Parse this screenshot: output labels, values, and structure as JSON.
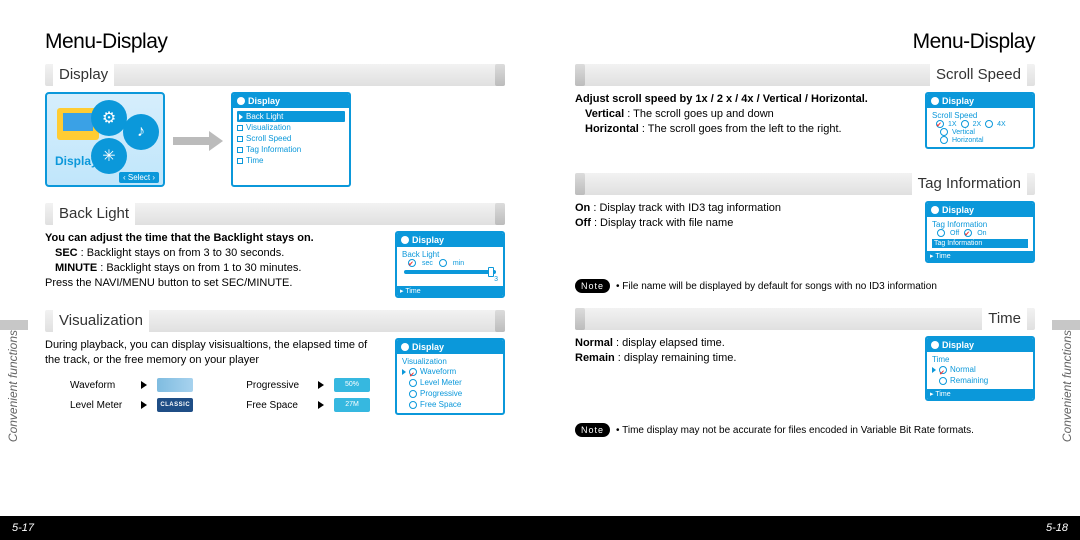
{
  "title": "Menu-Display",
  "section_side_text": "Convenient functions",
  "left": {
    "page_no": "5-17",
    "sections": {
      "display": {
        "title": "Display",
        "icon_label": "Display",
        "select_hint": "‹ Select ›",
        "shot": {
          "header": "Display",
          "selected": "Back Light",
          "items": [
            "Back Light",
            "Visualization",
            "Scroll Speed",
            "Tag Information",
            "Time"
          ]
        }
      },
      "backlight": {
        "title": "Back Light",
        "lead": "You can adjust the time that the Backlight stays on.",
        "line1a": "SEC",
        "line1b": " : Backlight stays on from 3 to 30 seconds.",
        "line2a": "MINUTE",
        "line2b": " : Backlight stays on from 1 to 30 minutes.",
        "line3": "Press the NAVI/MENU button to set SEC/MINUTE.",
        "shot": {
          "header": "Display",
          "sub": "Back Light",
          "opt1": "sec",
          "opt2": "min",
          "slider_val": "3",
          "time": "Time"
        }
      },
      "viz": {
        "title": "Visualization",
        "desc": "During playback, you can display visisualtions, the elapsed time of the track, or the free memory on your player",
        "items": {
          "waveform": "Waveform",
          "progressive": "Progressive",
          "levelmeter": "Level Meter",
          "freespace": "Free Space"
        },
        "chips": {
          "prog": "50%",
          "level": "CLASSIC",
          "free": "27M"
        },
        "shot": {
          "header": "Display",
          "sub": "Visualization",
          "items": [
            "Waveform",
            "Level Meter",
            "Progressive",
            "Free Space"
          ]
        }
      }
    }
  },
  "right": {
    "page_no": "5-18",
    "sections": {
      "scroll": {
        "title": "Scroll Speed",
        "lead": "Adjust scroll speed by 1x / 2 x / 4x / Vertical / Horizontal.",
        "l1a": "Vertical",
        "l1b": " : The scroll goes up and down",
        "l2a": "Horizontal",
        "l2b": " : The scroll goes from the left to the right.",
        "shot": {
          "header": "Display",
          "sub": "Scroll Speed",
          "row1": [
            "1X",
            "2X",
            "4X"
          ],
          "row2": [
            "Vertical"
          ],
          "row3": [
            "Horizontal"
          ]
        }
      },
      "tag": {
        "title": "Tag Information",
        "l1a": "On",
        "l1b": " : Display track with ID3 tag information",
        "l2a": "Off",
        "l2b": " : Display track with file name",
        "note": "File name will be displayed by default for songs with no ID3 information",
        "shot": {
          "header": "Display",
          "sub": "Tag Information",
          "opt1": "Off",
          "opt2": "On",
          "bar": "Tag Information",
          "time": "Time"
        }
      },
      "time": {
        "title": "Time",
        "l1a": "Normal",
        "l1b": " : display elapsed time.",
        "l2a": "Remain",
        "l2b": " : display remaining time.",
        "note": "Time display may not be accurate for files encoded in Variable Bit Rate formats.",
        "shot": {
          "header": "Display",
          "sub": "Time",
          "opt1": "Normal",
          "opt2": "Remaining",
          "time": "Time"
        }
      }
    }
  },
  "note_label": "Note"
}
